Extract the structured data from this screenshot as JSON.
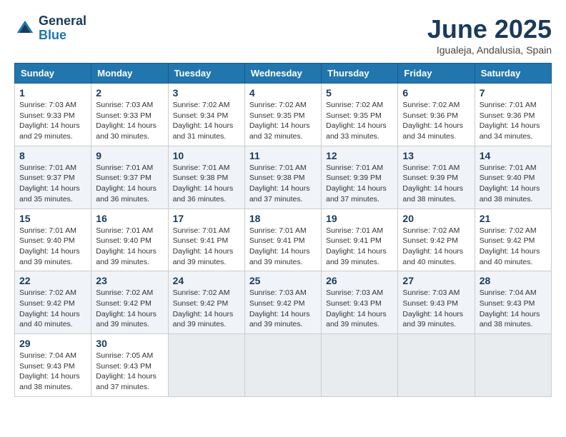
{
  "logo": {
    "line1": "General",
    "line2": "Blue"
  },
  "calendar": {
    "title": "June 2025",
    "subtitle": "Igualeja, Andalusia, Spain",
    "headers": [
      "Sunday",
      "Monday",
      "Tuesday",
      "Wednesday",
      "Thursday",
      "Friday",
      "Saturday"
    ],
    "weeks": [
      [
        {
          "day": "",
          "info": ""
        },
        {
          "day": "2",
          "info": "Sunrise: 7:03 AM\nSunset: 9:33 PM\nDaylight: 14 hours\nand 30 minutes."
        },
        {
          "day": "3",
          "info": "Sunrise: 7:02 AM\nSunset: 9:34 PM\nDaylight: 14 hours\nand 31 minutes."
        },
        {
          "day": "4",
          "info": "Sunrise: 7:02 AM\nSunset: 9:35 PM\nDaylight: 14 hours\nand 32 minutes."
        },
        {
          "day": "5",
          "info": "Sunrise: 7:02 AM\nSunset: 9:35 PM\nDaylight: 14 hours\nand 33 minutes."
        },
        {
          "day": "6",
          "info": "Sunrise: 7:02 AM\nSunset: 9:36 PM\nDaylight: 14 hours\nand 34 minutes."
        },
        {
          "day": "7",
          "info": "Sunrise: 7:01 AM\nSunset: 9:36 PM\nDaylight: 14 hours\nand 34 minutes."
        }
      ],
      [
        {
          "day": "8",
          "info": "Sunrise: 7:01 AM\nSunset: 9:37 PM\nDaylight: 14 hours\nand 35 minutes."
        },
        {
          "day": "9",
          "info": "Sunrise: 7:01 AM\nSunset: 9:37 PM\nDaylight: 14 hours\nand 36 minutes."
        },
        {
          "day": "10",
          "info": "Sunrise: 7:01 AM\nSunset: 9:38 PM\nDaylight: 14 hours\nand 36 minutes."
        },
        {
          "day": "11",
          "info": "Sunrise: 7:01 AM\nSunset: 9:38 PM\nDaylight: 14 hours\nand 37 minutes."
        },
        {
          "day": "12",
          "info": "Sunrise: 7:01 AM\nSunset: 9:39 PM\nDaylight: 14 hours\nand 37 minutes."
        },
        {
          "day": "13",
          "info": "Sunrise: 7:01 AM\nSunset: 9:39 PM\nDaylight: 14 hours\nand 38 minutes."
        },
        {
          "day": "14",
          "info": "Sunrise: 7:01 AM\nSunset: 9:40 PM\nDaylight: 14 hours\nand 38 minutes."
        }
      ],
      [
        {
          "day": "15",
          "info": "Sunrise: 7:01 AM\nSunset: 9:40 PM\nDaylight: 14 hours\nand 39 minutes."
        },
        {
          "day": "16",
          "info": "Sunrise: 7:01 AM\nSunset: 9:40 PM\nDaylight: 14 hours\nand 39 minutes."
        },
        {
          "day": "17",
          "info": "Sunrise: 7:01 AM\nSunset: 9:41 PM\nDaylight: 14 hours\nand 39 minutes."
        },
        {
          "day": "18",
          "info": "Sunrise: 7:01 AM\nSunset: 9:41 PM\nDaylight: 14 hours\nand 39 minutes."
        },
        {
          "day": "19",
          "info": "Sunrise: 7:01 AM\nSunset: 9:41 PM\nDaylight: 14 hours\nand 39 minutes."
        },
        {
          "day": "20",
          "info": "Sunrise: 7:02 AM\nSunset: 9:42 PM\nDaylight: 14 hours\nand 40 minutes."
        },
        {
          "day": "21",
          "info": "Sunrise: 7:02 AM\nSunset: 9:42 PM\nDaylight: 14 hours\nand 40 minutes."
        }
      ],
      [
        {
          "day": "22",
          "info": "Sunrise: 7:02 AM\nSunset: 9:42 PM\nDaylight: 14 hours\nand 40 minutes."
        },
        {
          "day": "23",
          "info": "Sunrise: 7:02 AM\nSunset: 9:42 PM\nDaylight: 14 hours\nand 39 minutes."
        },
        {
          "day": "24",
          "info": "Sunrise: 7:02 AM\nSunset: 9:42 PM\nDaylight: 14 hours\nand 39 minutes."
        },
        {
          "day": "25",
          "info": "Sunrise: 7:03 AM\nSunset: 9:42 PM\nDaylight: 14 hours\nand 39 minutes."
        },
        {
          "day": "26",
          "info": "Sunrise: 7:03 AM\nSunset: 9:43 PM\nDaylight: 14 hours\nand 39 minutes."
        },
        {
          "day": "27",
          "info": "Sunrise: 7:03 AM\nSunset: 9:43 PM\nDaylight: 14 hours\nand 39 minutes."
        },
        {
          "day": "28",
          "info": "Sunrise: 7:04 AM\nSunset: 9:43 PM\nDaylight: 14 hours\nand 38 minutes."
        }
      ],
      [
        {
          "day": "29",
          "info": "Sunrise: 7:04 AM\nSunset: 9:43 PM\nDaylight: 14 hours\nand 38 minutes."
        },
        {
          "day": "30",
          "info": "Sunrise: 7:05 AM\nSunset: 9:43 PM\nDaylight: 14 hours\nand 37 minutes."
        },
        {
          "day": "",
          "info": ""
        },
        {
          "day": "",
          "info": ""
        },
        {
          "day": "",
          "info": ""
        },
        {
          "day": "",
          "info": ""
        },
        {
          "day": "",
          "info": ""
        }
      ]
    ],
    "week1_day1": {
      "day": "1",
      "info": "Sunrise: 7:03 AM\nSunset: 9:33 PM\nDaylight: 14 hours\nand 29 minutes."
    }
  }
}
